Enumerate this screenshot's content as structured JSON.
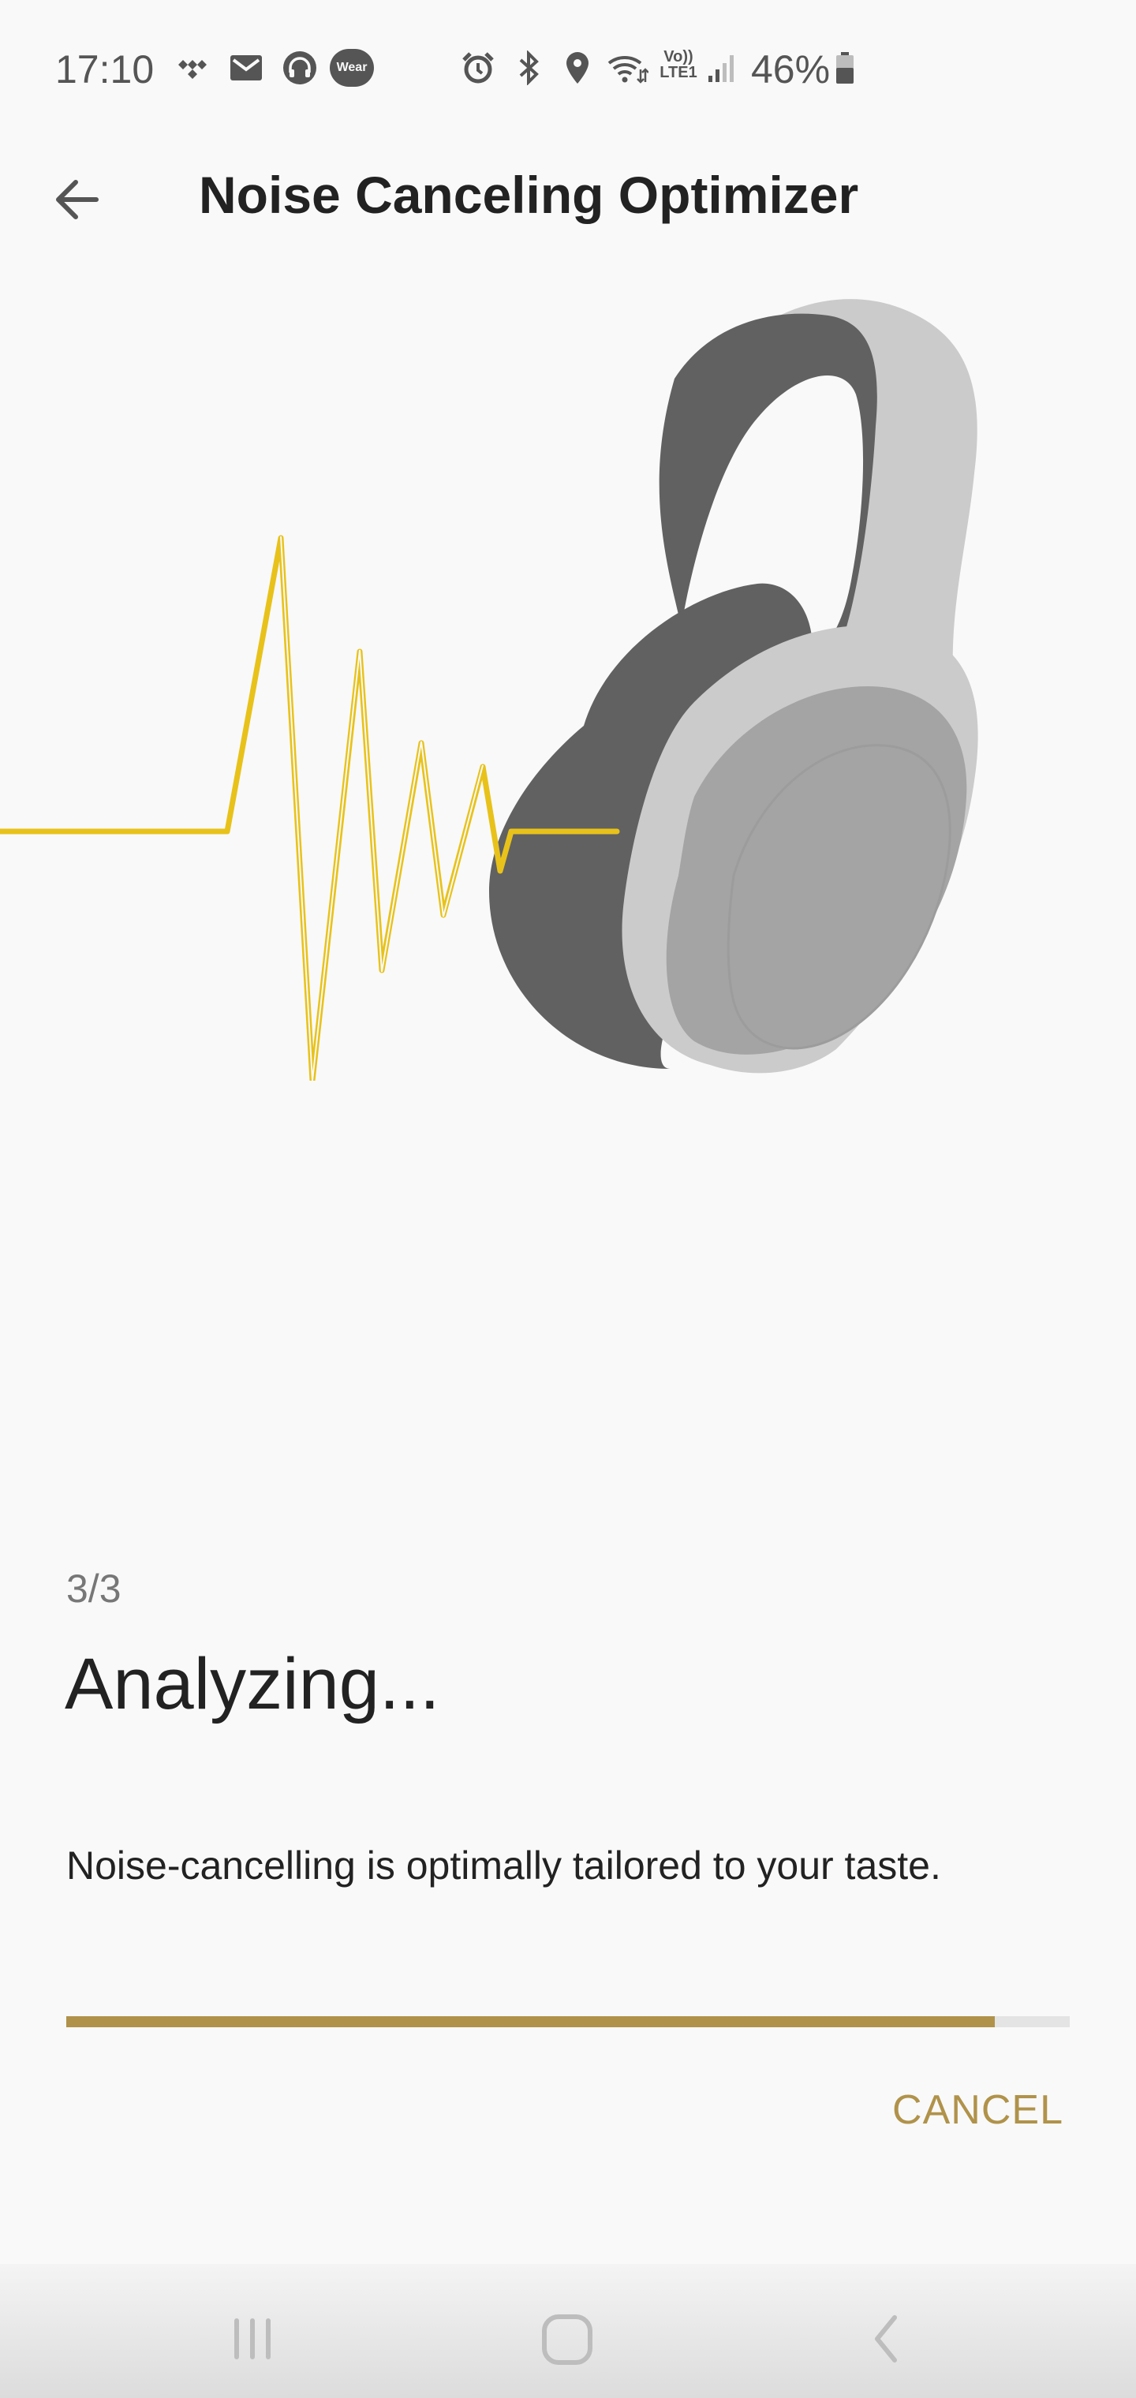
{
  "status_bar": {
    "time": "17:10",
    "battery_percent": "46%",
    "wear_label": "Wear",
    "volte_label": "Vo)) LTE1",
    "icons": [
      "tidal-icon",
      "mail-icon",
      "headphones-app-icon",
      "wear-icon",
      "alarm-icon",
      "bluetooth-icon",
      "location-icon",
      "wifi-icon",
      "volte-icon",
      "signal-icon",
      "battery-icon"
    ]
  },
  "app_bar": {
    "title": "Noise Canceling Optimizer",
    "back_icon": "arrow-left-icon"
  },
  "illustration": {
    "wave_color": "#e8c21a",
    "headphone_dark": "#616161",
    "headphone_light": "#cbcbcb",
    "headphone_mid": "#a4a4a4"
  },
  "content": {
    "step": "3/3",
    "heading": "Analyzing...",
    "description": "Noise-cancelling is optimally tailored to your taste.",
    "progress": 0.925,
    "progress_color": "#b0924a",
    "track_color": "#e4e4e4"
  },
  "actions": {
    "cancel_label": "CANCEL"
  },
  "nav_bar": {
    "icons": [
      "recent-apps-icon",
      "home-icon",
      "back-icon"
    ]
  }
}
